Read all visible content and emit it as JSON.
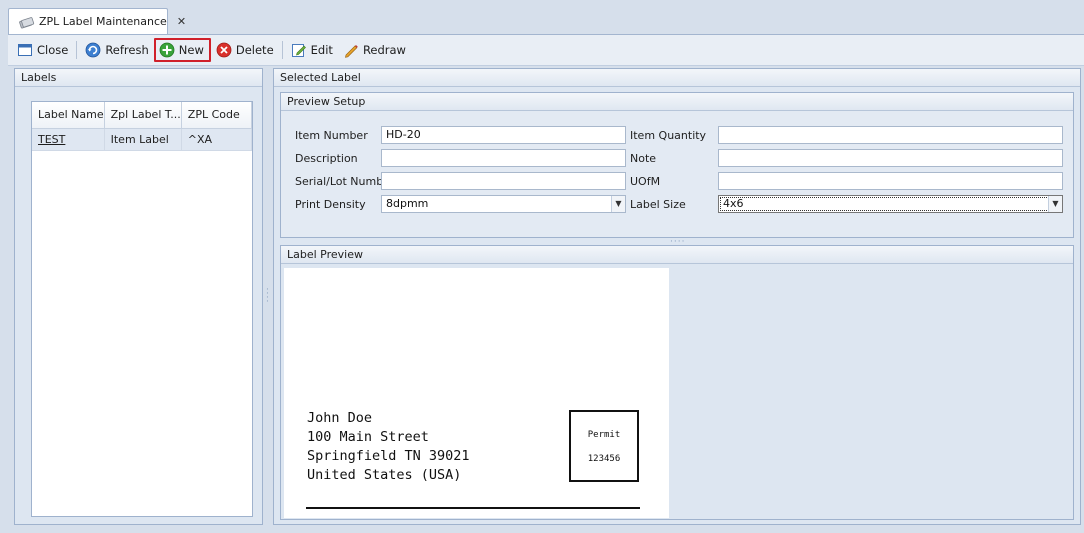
{
  "tab": {
    "label": "ZPL Label Maintenance",
    "close_glyph": "✕",
    "icon": "label-stack-icon"
  },
  "toolbar": {
    "close_label": "Close",
    "refresh_label": "Refresh",
    "new_label": "New",
    "delete_label": "Delete",
    "edit_label": "Edit",
    "redraw_label": "Redraw"
  },
  "labels_panel": {
    "title": "Labels",
    "columns": [
      "Label Name",
      "Zpl Label T...",
      "ZPL Code"
    ],
    "rows": [
      {
        "name": "TEST",
        "type": "Item Label",
        "code": "^XA"
      }
    ]
  },
  "selected_panel": {
    "title": "Selected Label"
  },
  "preview_setup": {
    "title": "Preview Setup",
    "item_number_label": "Item Number",
    "item_number_value": "HD-20",
    "description_label": "Description",
    "description_value": "",
    "serial_label": "Serial/Lot Number",
    "serial_value": "",
    "print_density_label": "Print Density",
    "print_density_value": "8dpmm",
    "item_quantity_label": "Item Quantity",
    "item_quantity_value": "",
    "note_label": "Note",
    "note_value": "",
    "uofm_label": "UOfM",
    "uofm_value": "",
    "label_size_label": "Label Size",
    "label_size_value": "4x6"
  },
  "label_preview": {
    "title": "Label Preview",
    "address": [
      "John Doe",
      "100 Main Street",
      "Springfield TN 39021",
      "United States (USA)"
    ],
    "permit_title": "Permit",
    "permit_number": "123456"
  },
  "colors": {
    "accent_highlight": "#d0202a",
    "background": "#d6dfeb",
    "row_selected": "#dfe7f2"
  }
}
